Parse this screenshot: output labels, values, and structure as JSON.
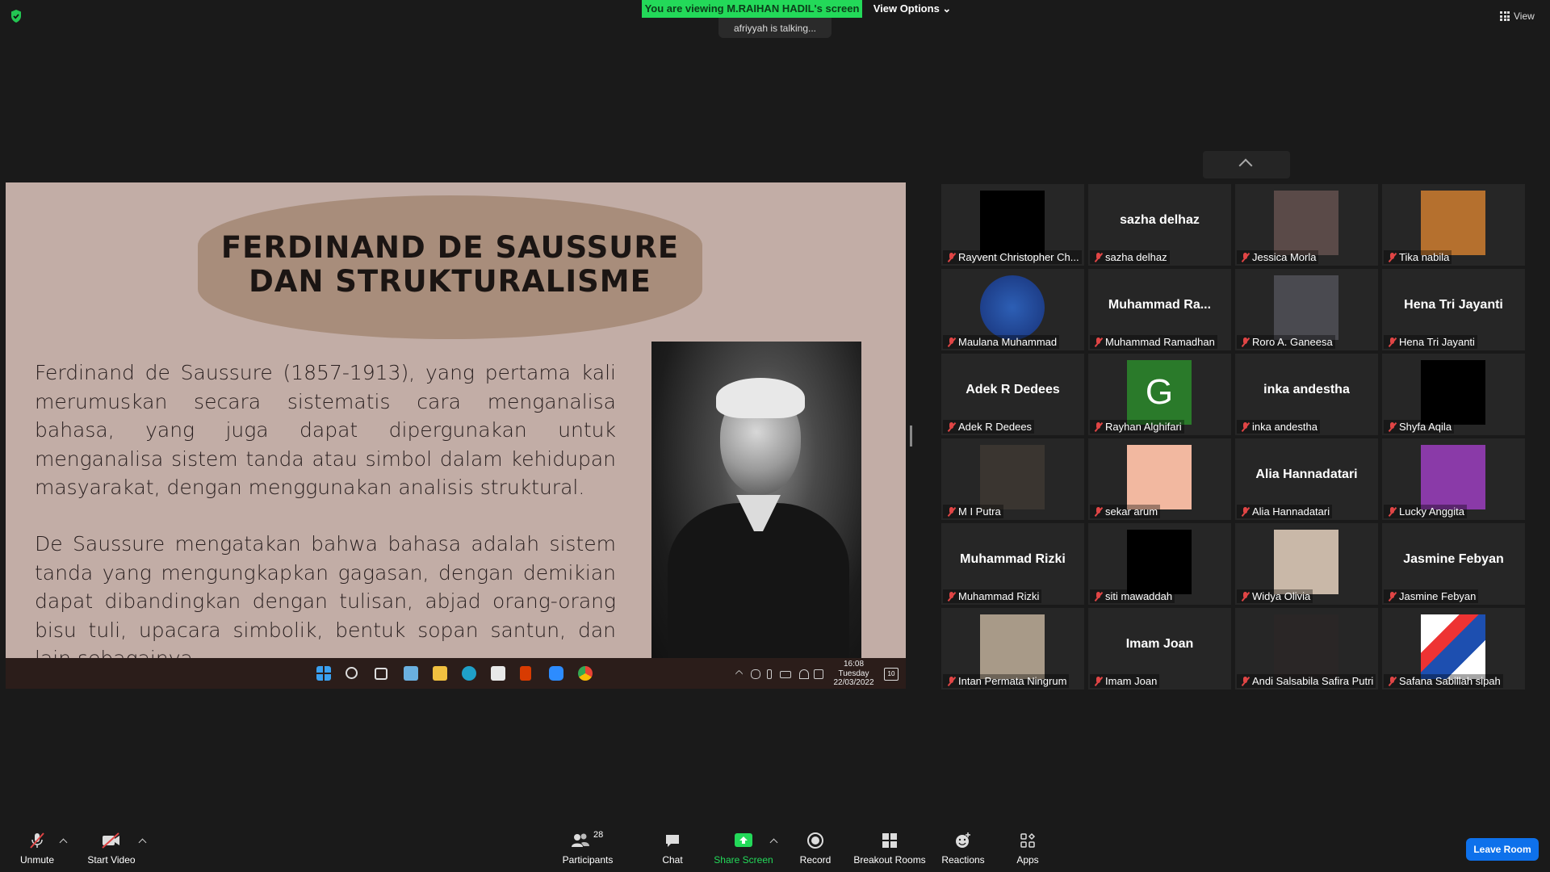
{
  "top": {
    "viewing_banner": "You are viewing M.RAIHAN HADIL's screen",
    "view_options": "View Options ⌄",
    "talking": "afriyyah  is talking...",
    "view_label": "View"
  },
  "slide": {
    "title": "FERDINAND DE SAUSSURE DAN STRUKTURALISME",
    "paragraph1": "Ferdinand de Saussure (1857-1913), yang pertama kali merumuskan secara sistematis cara menganalisa bahasa, yang juga dapat dipergunakan untuk menganalisa sistem tanda atau simbol dalam kehidupan masyarakat, dengan menggunakan analisis struktural.",
    "paragraph2": "De Saussure mengatakan bahwa bahasa adalah sistem tanda yang mengungkapkan gagasan, dengan demikian dapat dibandingkan dengan tulisan, abjad orang-orang bisu tuli, upacara simbolik, bentuk sopan santun, dan lain sebagainya."
  },
  "windows_taskbar": {
    "time": "16:08",
    "day": "Tuesday",
    "date": "22/03/2022",
    "notifications": "10"
  },
  "participants_tiles": [
    {
      "big": "",
      "label": "Rayvent Christopher Ch...",
      "thumb": "#000000"
    },
    {
      "big": "sazha delhaz",
      "label": "sazha delhaz",
      "thumb": ""
    },
    {
      "big": "",
      "label": "Jessica Morla",
      "thumb": "#5a4a48"
    },
    {
      "big": "",
      "label": "Tika nabila",
      "thumb": "#b5702e"
    },
    {
      "big": "",
      "label": "Maulana Muhammad",
      "thumb": "genpro"
    },
    {
      "big": "Muhammad  Ra...",
      "label": "Muhammad Ramadhan",
      "thumb": ""
    },
    {
      "big": "",
      "label": "Roro A. Ganeesa",
      "thumb": "#4a4a50"
    },
    {
      "big": "Hena Tri Jayanti",
      "label": "Hena Tri Jayanti",
      "thumb": ""
    },
    {
      "big": "Adek R Dedees",
      "label": "Adek R Dedees",
      "thumb": ""
    },
    {
      "big": "",
      "label": "Rayhan Alghifari",
      "thumb": "G"
    },
    {
      "big": "inka andestha",
      "label": "inka andestha",
      "thumb": ""
    },
    {
      "big": "",
      "label": "Shyfa Aqila",
      "thumb": "#000000"
    },
    {
      "big": "",
      "label": "M I Putra",
      "thumb": "#3a3530"
    },
    {
      "big": "",
      "label": "sekar arum",
      "thumb": "#f2b8a0"
    },
    {
      "big": "Alia Hannadatari",
      "label": "Alia Hannadatari",
      "thumb": ""
    },
    {
      "big": "",
      "label": "Lucky Anggita",
      "thumb": "#8a3aa8"
    },
    {
      "big": "Muhammad Rizki",
      "label": "Muhammad Rizki",
      "thumb": ""
    },
    {
      "big": "",
      "label": "siti mawaddah",
      "thumb": "#000000"
    },
    {
      "big": "",
      "label": "Widya Olivia",
      "thumb": "#c9b8a8"
    },
    {
      "big": "Jasmine Febyan",
      "label": "Jasmine Febyan",
      "thumb": ""
    },
    {
      "big": "",
      "label": "Intan Permata Ningrum",
      "thumb": "#a89a88"
    },
    {
      "big": "Imam Joan",
      "label": "Imam Joan",
      "thumb": ""
    },
    {
      "big": "",
      "label": "Andi Salsabila Safira Putri",
      "thumb": "#2a2626"
    },
    {
      "big": "",
      "label": "Safana Sabillah sipah",
      "thumb": "logo"
    }
  ],
  "toolbar": {
    "unmute": "Unmute",
    "start_video": "Start Video",
    "participants": "Participants",
    "participants_count": "28",
    "chat": "Chat",
    "share_screen": "Share Screen",
    "record": "Record",
    "breakout_rooms": "Breakout Rooms",
    "reactions": "Reactions",
    "apps": "Apps",
    "leave_room": "Leave Room"
  },
  "colors": {
    "accent_green": "#23d959",
    "leave_blue": "#0e71eb",
    "muted_red": "#e04545",
    "slide_bg": "#c2ada6",
    "title_shape": "#a88d7b"
  }
}
